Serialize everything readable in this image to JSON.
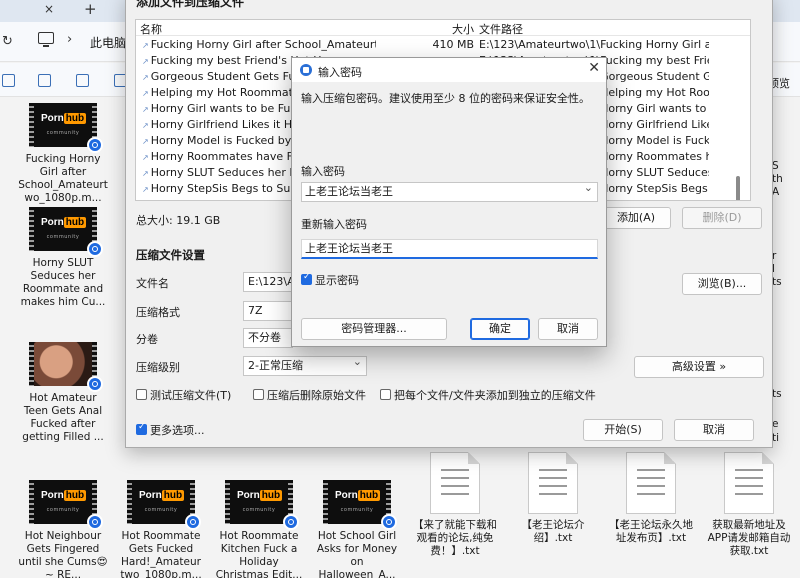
{
  "explorer": {
    "tab_close": "×",
    "tab_new": "+",
    "breadcrumb": "此电脑",
    "preview_label": "预览",
    "thumbnails": [
      {
        "caption": "Fucking Horny Girl after School_Amateurtwo_1080p.m...",
        "kind": "logo"
      },
      {
        "caption": "Horny SLUT Seduces her Roommate and makes him Cu...",
        "kind": "logo"
      },
      {
        "caption": "Hot Amateur Teen Gets Anal Fucked after getting Filled ...",
        "kind": "photo"
      },
      {
        "caption": "Hot Neighbour Gets Fingered until she Cums😍 ~ RE...",
        "kind": "logo"
      },
      {
        "caption": "Hot Roommate Gets Fucked Hard!_Amateur two_1080p.m...",
        "kind": "logo"
      },
      {
        "caption": "Hot Roommate Kitchen Fuck a Holiday Christmas Edit...",
        "kind": "logo"
      },
      {
        "caption": "Hot School Girl Asks for Money on Halloween_A...",
        "kind": "logo"
      }
    ],
    "logo_text_a": "Porn",
    "logo_text_b": "hub",
    "logo_sub": "community",
    "txt_files": [
      {
        "caption": "【来了就能下载和观看的论坛,纯免费！】.txt"
      },
      {
        "caption": "【老王论坛介绍】.txt"
      },
      {
        "caption": "【老王论坛永久地址发布页】.txt"
      },
      {
        "caption": "获取最新地址及APP请发邮箱自动获取.txt"
      }
    ],
    "right_strip": [
      "S",
      "th",
      "A",
      "r",
      "l",
      "ts",
      "",
      "ts",
      "e",
      "ti"
    ]
  },
  "archive_dialog": {
    "title": "添加文件到压缩文件",
    "columns": {
      "name": "名称",
      "size": "大小",
      "path": "文件路径"
    },
    "files": [
      {
        "name": "Fucking Horny Girl after School_Amateurtwo...",
        "size": "410 MB",
        "path": "E:\\123\\Amateurtwo\\1\\Fucking Horny Girl aft..."
      },
      {
        "name": "Fucking my best Friend's Hot Ho...",
        "size": "",
        "path": "E:\\123\\Amateurtwo\\1\\Fucking my best Frien..."
      },
      {
        "name": "Gorgeous Student Gets Fuck...",
        "size": "",
        "path": "E:\\123\\Amateurtwo\\1\\Gorgeous Student Ge..."
      },
      {
        "name": "Helping my Hot Roommate ...",
        "size": "",
        "path": "E:\\123\\Amateurtwo\\1\\Helping my Hot Roo..."
      },
      {
        "name": "Horny Girl wants to be Fuck...",
        "size": "",
        "path": "E:\\123\\Amateurtwo\\1\\Horny Girl wants to b..."
      },
      {
        "name": "Horny Girlfriend Likes it Har...",
        "size": "",
        "path": "E:\\123\\Amateurtwo\\1\\Horny Girlfriend Likes ..."
      },
      {
        "name": "Horny Model is Fucked by t...",
        "size": "",
        "path": "E:\\123\\Amateurtwo\\1\\Horny Model is Fucke..."
      },
      {
        "name": "Horny Roommates have Fu...",
        "size": "",
        "path": "E:\\123\\Amateurtwo\\1\\Horny Roommates ha..."
      },
      {
        "name": "Horny SLUT Seduces her Ro...",
        "size": "",
        "path": "E:\\123\\Amateurtwo\\1\\Horny SLUT Seduces ..."
      },
      {
        "name": "Horny StepSis Begs to Suck...",
        "size": "",
        "path": "E:\\123\\Amateurtwo\\1\\Horny StepSis Begs to..."
      }
    ],
    "total_size": "总大小: 19.1 GB",
    "add_button": "添加(A)",
    "delete_button": "删除(D)",
    "settings_section": "压缩文件设置",
    "filename_label": "文件名",
    "filename_value": "E:\\123\\Ar",
    "browse_button": "浏览(B)...",
    "format_label": "压缩格式",
    "format_value": "7Z",
    "split_label": "分卷",
    "split_value": "不分卷",
    "level_label": "压缩级别",
    "level_value": "2-正常压缩",
    "advanced_button": "高级设置 »",
    "test_archive": "测试压缩文件(T)",
    "delete_after": "压缩后删除原始文件",
    "separate_archive": "把每个文件/文件夹添加到独立的压缩文件",
    "more_options": "更多选项...",
    "start_button": "开始(S)",
    "cancel_button": "取消"
  },
  "password_dialog": {
    "title": "输入密码",
    "close_glyph": "✕",
    "message": "输入压缩包密码。建议使用至少 8 位的密码来保证安全性。",
    "password_label": "输入密码",
    "password_value": "上老王论坛当老王",
    "confirm_label": "重新输入密码",
    "confirm_value": "上老王论坛当老王",
    "show_password": "显示密码",
    "manager_button": "密码管理器...",
    "ok_button": "确定",
    "cancel_button": "取消",
    "accent": "#1f6ae0"
  }
}
